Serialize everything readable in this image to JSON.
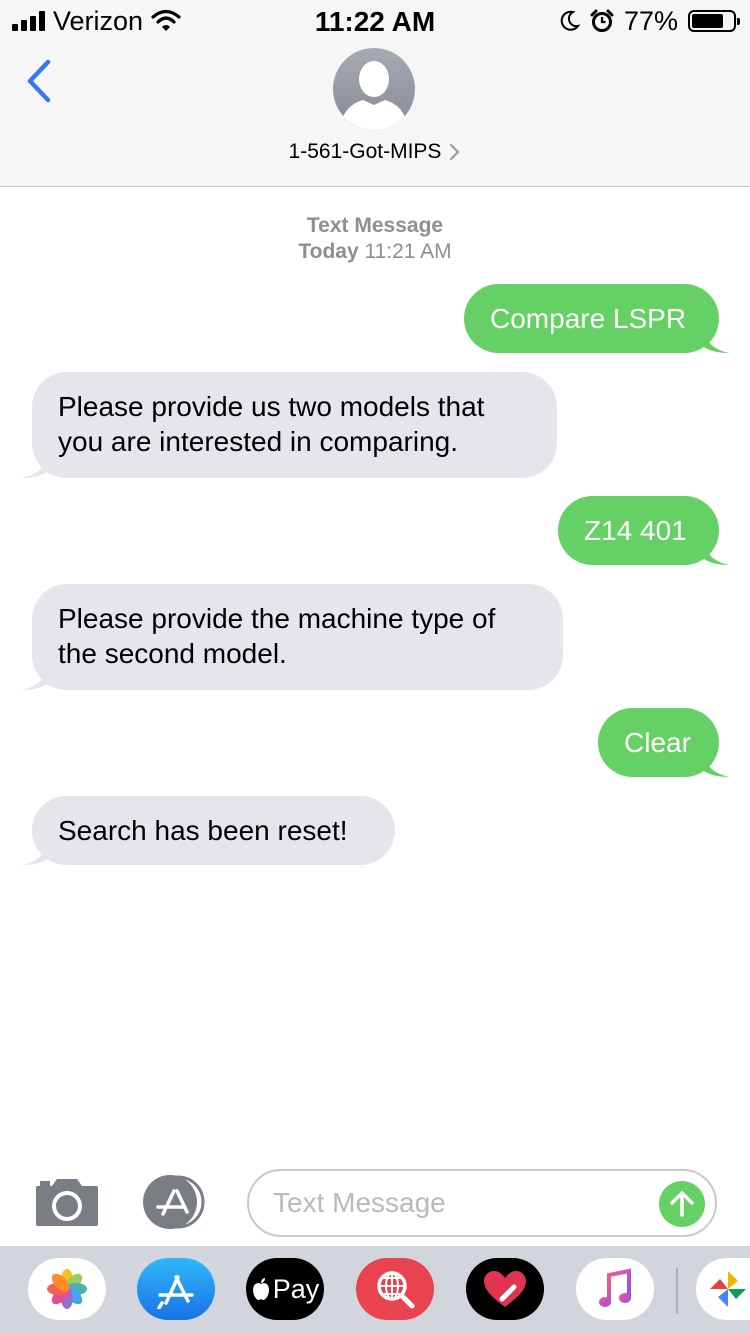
{
  "status_bar": {
    "carrier": "Verizon",
    "time": "11:22 AM",
    "battery_percent": "77%",
    "battery_level": 0.77,
    "icons": [
      "signal-icon",
      "wifi-icon",
      "moon-icon",
      "alarm-icon",
      "battery-icon"
    ]
  },
  "header": {
    "back_icon": "chevron-left-icon",
    "contact_name": "1-561-Got-MIPS",
    "disclosure_icon": "chevron-right-icon"
  },
  "conversation": {
    "service_label": "Text Message",
    "date_label": "Today",
    "time_label": "11:21 AM",
    "messages": [
      {
        "direction": "outgoing",
        "lines": [
          "Compare LSPR"
        ]
      },
      {
        "direction": "incoming",
        "lines": [
          "Please provide us two models that",
          "you are interested in comparing."
        ]
      },
      {
        "direction": "outgoing",
        "lines": [
          "Z14 401"
        ]
      },
      {
        "direction": "incoming",
        "lines": [
          "Please provide the machine type of",
          "the second model."
        ]
      },
      {
        "direction": "outgoing",
        "lines": [
          "Clear"
        ]
      },
      {
        "direction": "incoming",
        "lines": [
          "Search has been reset!"
        ]
      }
    ]
  },
  "input_bar": {
    "placeholder": "Text Message",
    "value": "",
    "camera_icon": "camera-icon",
    "apps_icon": "app-store-icon",
    "send_icon": "send-arrow-icon"
  },
  "app_drawer": {
    "apps": [
      {
        "name": "photos-app-icon"
      },
      {
        "name": "app-store-app-icon"
      },
      {
        "name": "apple-pay-app-icon",
        "label": "Pay"
      },
      {
        "name": "search-images-app-icon"
      },
      {
        "name": "digital-touch-app-icon"
      },
      {
        "name": "music-app-icon"
      },
      {
        "name": "pinwheel-app-icon"
      }
    ]
  },
  "colors": {
    "outgoing_bubble": "#65d064",
    "incoming_bubble": "#e6e5eb",
    "accent_blue": "#3478f6",
    "meta_gray": "#8e8e93"
  }
}
